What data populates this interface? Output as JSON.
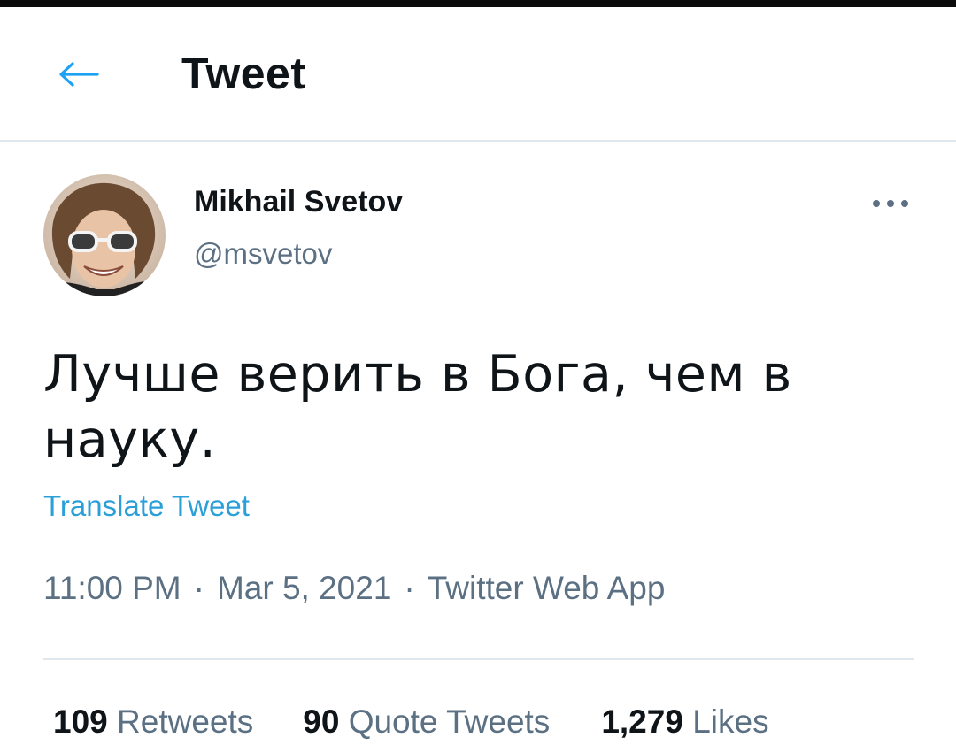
{
  "header": {
    "back_icon": "arrow-left-icon",
    "title": "Tweet"
  },
  "author": {
    "avatar_icon": "avatar-photo",
    "display_name": "Mikhail Svetov",
    "handle": "@msvetov",
    "more_icon": "more-horizontal-icon"
  },
  "tweet": {
    "text": "Лучше верить в Бога, чем в науку.",
    "translate_label": "Translate Tweet",
    "time": "11:00 PM",
    "date": "Mar 5, 2021",
    "source": "Twitter Web App",
    "separator": "·"
  },
  "stats": {
    "retweets_count": "109",
    "retweets_label": "Retweets",
    "quotes_count": "90",
    "quotes_label": "Quote Tweets",
    "likes_count": "1,279",
    "likes_label": "Likes"
  },
  "colors": {
    "accent": "#1da1f2",
    "text_primary": "#0f1419",
    "text_secondary": "#5b7083",
    "divider": "#e1e8ed"
  }
}
